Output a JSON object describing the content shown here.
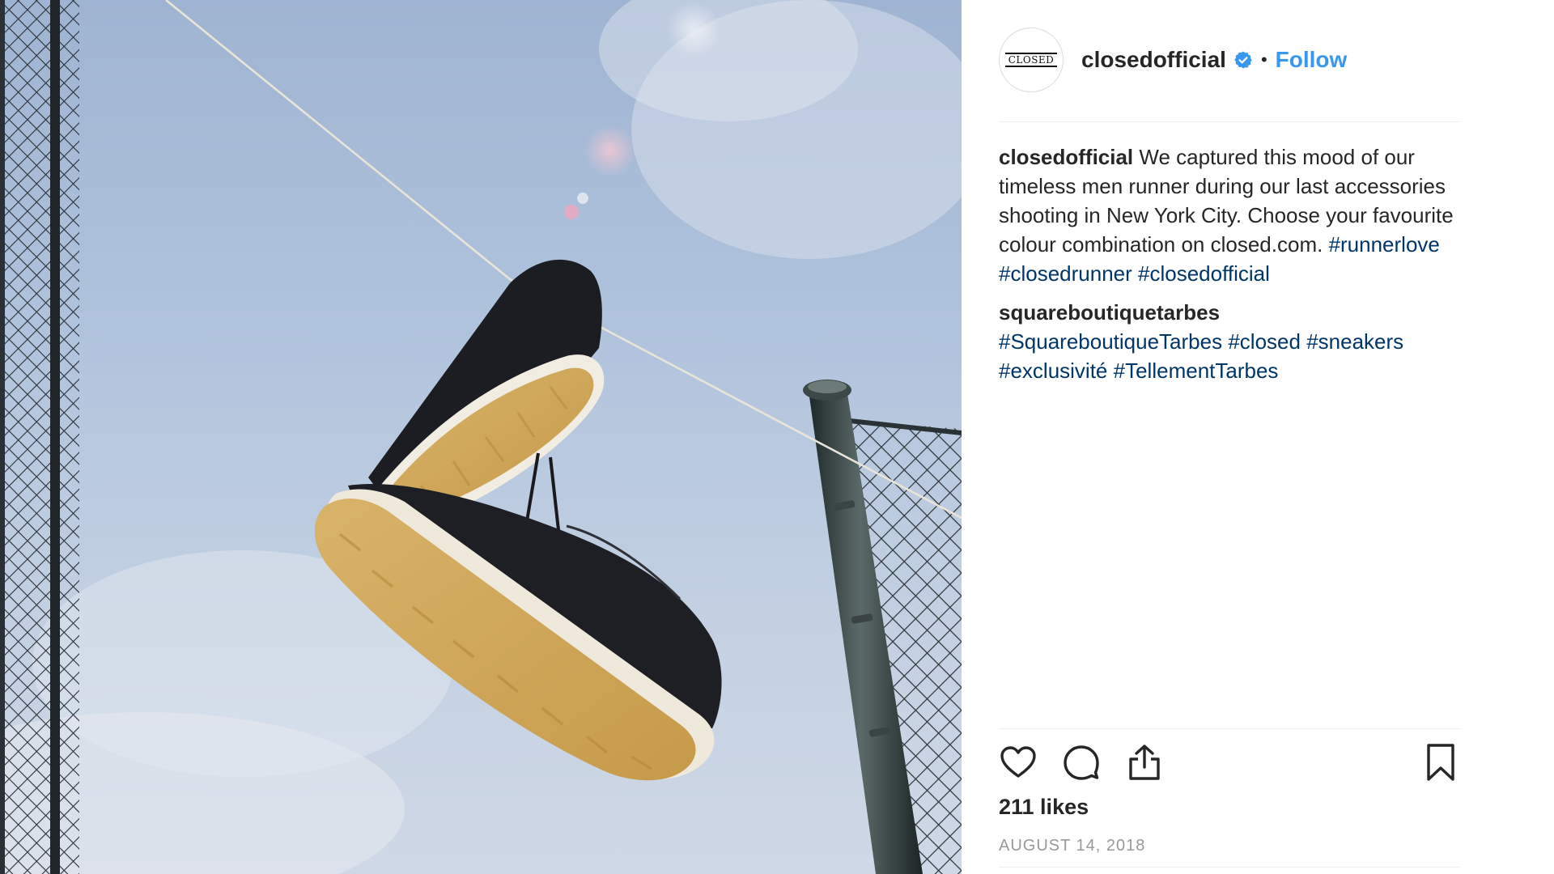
{
  "post": {
    "author": "closedofficial",
    "avatar_logo_text": "CLOSED",
    "verified": true,
    "separator": "•",
    "follow_label": "Follow",
    "photo_subject": "photo"
  },
  "comments": [
    {
      "user": "closedofficial",
      "text_before": " We captured this mood of our timeless men runner during our last accessories shooting in New York City. Choose your favourite colour combination on closed.com.",
      "tags": [
        "#runnerlove",
        "#closedrunner",
        "#closedofficial"
      ]
    },
    {
      "user": "squareboutiquetarbes",
      "text_before": "",
      "tags": [
        "#SquareboutiqueTarbes",
        "#closed",
        "#sneakers",
        "#exclusivité",
        "#TellementTarbes"
      ]
    }
  ],
  "actions": {
    "like_icon": "heart-icon",
    "comment_icon": "comment-bubble-icon",
    "share_icon": "share-icon",
    "save_icon": "bookmark-icon"
  },
  "likes_text": "211 likes",
  "date_text": "AUGUST 14, 2018",
  "colors": {
    "link_blue": "#3897f0",
    "hashtag_blue": "#003569",
    "text": "#262626",
    "muted": "#999999",
    "divider": "#efefef"
  }
}
